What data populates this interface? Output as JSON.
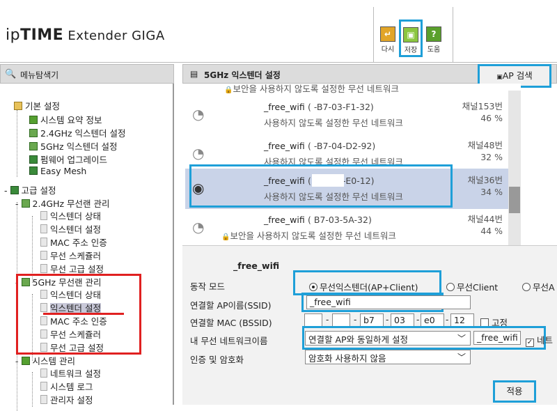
{
  "header": {
    "logo_ip": "ip",
    "logo_time": "TIME",
    "logo_rest": " Extender GIGA",
    "toolbar": [
      {
        "label": "다시",
        "icon": "refresh-icon",
        "color": "#e2a528"
      },
      {
        "label": "저장",
        "icon": "save-icon",
        "color": "#8cc63f"
      },
      {
        "label": "도움",
        "icon": "help-icon",
        "color": "#5aa02c"
      }
    ]
  },
  "left": {
    "title": "메뉴탐색기",
    "basic": {
      "label": "기본 설정",
      "items": [
        "시스템 요약 정보",
        "2.4GHz 익스텐더 설정",
        "5GHz 익스텐더 설정",
        "펌웨어 업그레이드",
        "Easy Mesh"
      ]
    },
    "advanced": {
      "label": "고급 설정",
      "g24": {
        "label": "2.4GHz 무선랜 관리",
        "items": [
          "익스텐더 상태",
          "익스텐더 설정",
          "MAC 주소 인증",
          "무선 스케쥴러",
          "무선 고급 설정"
        ]
      },
      "g5": {
        "label": "5GHz 무선랜 관리",
        "items": [
          "익스텐더 상태",
          "익스텐더 설정",
          "MAC 주소 인증",
          "무선 스케쥴러",
          "무선 고급 설정"
        ]
      },
      "sys": {
        "label": "시스템 관리",
        "items": [
          "네트워크 설정",
          "시스템 로그",
          "관리자 설정"
        ]
      }
    }
  },
  "right": {
    "title": "5GHz 익스텐더 설정",
    "ap_search": "AP 검색",
    "top_partial": "보안을 사용하지 않도록 설정한 무선 네트워크",
    "ap_list": [
      {
        "ssid": "_free_wifi",
        "mac": "(          -B7-03-F1-32)",
        "desc": "사용하지 않도록 설정한 무선 네트워크",
        "channel": "채널153번",
        "signal": "46 %"
      },
      {
        "ssid": "_free_wifi",
        "mac": "(          -B7-04-D2-92)",
        "desc": "사용하지 않도록 설정한 무선 네트워크",
        "channel": "채널48번",
        "signal": "32 %"
      },
      {
        "ssid": "_free_wifi",
        "mac": "(          -B7-03-E0-12)",
        "desc": "사용하지 않도록 설정한 무선 네트워크",
        "channel": "채널36번",
        "signal": "34 %"
      },
      {
        "ssid": "_free_wifi",
        "mac": "(          B7-03-5A-32)",
        "desc": "보안을 사용하지 않도록 설정한 무선 네트워크",
        "channel": "채널44번",
        "signal": "44 %"
      }
    ],
    "form": {
      "name": "_free_wifi",
      "mode_label": "동작 모드",
      "mode_options": [
        "무선익스텐더(AP+Client)",
        "무선Client",
        "무선A"
      ],
      "ssid_label": "연결할 AP이름(SSID)",
      "ssid_value": "_free_wifi",
      "bssid_label": "연결할 MAC (BSSID)",
      "bssid": [
        "",
        "",
        "b7",
        "03",
        "e0",
        "12"
      ],
      "fixed_label": "고정",
      "mynet_label": "내 무선 네트워크이름",
      "mynet_select": "연결할 AP와 동일하게 설정",
      "mynet_value": "_free_wifi",
      "mynet_chk_label": "네트",
      "auth_label": "인증 및 암호화",
      "auth_select": "암호화 사용하지 않음",
      "apply": "적용"
    }
  }
}
